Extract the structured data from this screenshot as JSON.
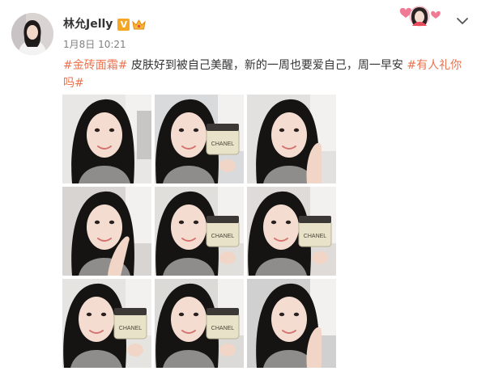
{
  "post": {
    "user_name": "林允Jelly",
    "verified_badge": "V",
    "timestamp": "1月8日 10:21",
    "content": {
      "tag1": "#金砖面霜#",
      "text": " 皮肤好到被自己美醒，新的一周也要爱自己，周一早安 ",
      "tag2": "#有人礼你吗#"
    },
    "product_label": "CHANEL",
    "images": [
      {
        "name": "photo-1",
        "pose": "head-tilt"
      },
      {
        "name": "photo-2",
        "pose": "jar"
      },
      {
        "name": "photo-3",
        "pose": "hand-cheek"
      },
      {
        "name": "photo-4",
        "pose": "finger-lips"
      },
      {
        "name": "photo-5",
        "pose": "jar"
      },
      {
        "name": "photo-6",
        "pose": "jar"
      },
      {
        "name": "photo-7",
        "pose": "jar"
      },
      {
        "name": "photo-8",
        "pose": "jar"
      },
      {
        "name": "photo-9",
        "pose": "hand-cheek"
      }
    ]
  },
  "icons": {
    "verified": "verified-v-icon",
    "member": "member-crown-icon",
    "menu": "chevron-down-icon",
    "card_decoration": "heart-card-decoration"
  },
  "colors": {
    "tag": "#eb7350",
    "verified": "#f5a623",
    "timestamp": "#808080"
  }
}
